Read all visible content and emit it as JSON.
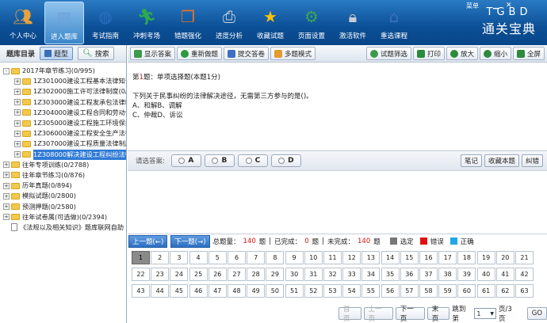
{
  "topbar": {
    "buttons": [
      {
        "label": "个人中心",
        "icon": "user-icon",
        "color": "#e9a13b"
      },
      {
        "label": "进入题库",
        "icon": "books-icon",
        "color": "#6ea0d8"
      },
      {
        "label": "考试指南",
        "icon": "globe-icon",
        "color": "#2a6fc0"
      },
      {
        "label": "冲刺考场",
        "icon": "runner-icon",
        "color": "#2fa84f"
      },
      {
        "label": "错题强化",
        "icon": "book-icon",
        "color": "#e3722b"
      },
      {
        "label": "进度分析",
        "icon": "printer-icon",
        "color": "#cfd5dd"
      },
      {
        "label": "收藏试题",
        "icon": "star-icon",
        "color": "#f4c20d"
      },
      {
        "label": "页面设置",
        "icon": "gear-icon",
        "color": "#3ea651"
      },
      {
        "label": "激活软件",
        "icon": "lock-icon",
        "color": "#c8ccd3"
      },
      {
        "label": "重选课程",
        "icon": "home-icon",
        "color": "#3d6fc4"
      }
    ],
    "menu_caption": "菜单",
    "brand_en": "TGBD",
    "brand_cn": "通关宝典"
  },
  "left": {
    "title": "题库目录",
    "btn_type": "题型",
    "btn_search": "搜索",
    "tree": [
      {
        "label": "2017年章节练习(0/995)",
        "level": 0,
        "pm": "-"
      },
      {
        "label": "1Z301000建设工程基本法律知识",
        "level": 1,
        "pm": "+"
      },
      {
        "label": "1Z302000施工许可法律制度(0/8",
        "level": 1,
        "pm": "+"
      },
      {
        "label": "1Z303000建设工程发承包法律制",
        "level": 1,
        "pm": "+"
      },
      {
        "label": "1Z304000建设工程合同和劳动合",
        "level": 1,
        "pm": "+"
      },
      {
        "label": "1Z305000建设工程施工环境保护",
        "level": 1,
        "pm": "+"
      },
      {
        "label": "1Z306000建设工程安全生产法律",
        "level": 1,
        "pm": "+"
      },
      {
        "label": "1Z307000建设工程质量法律制度",
        "level": 1,
        "pm": "+"
      },
      {
        "label": "1Z308000解决建设工程纠纷法律",
        "level": 1,
        "pm": "+",
        "selected": true
      },
      {
        "label": "往年专项训练(0/2788)",
        "level": 0,
        "pm": "+"
      },
      {
        "label": "往年章节练习(0/876)",
        "level": 0,
        "pm": "+"
      },
      {
        "label": "历年真题(0/894)",
        "level": 0,
        "pm": "+"
      },
      {
        "label": "模拟试题(0/2800)",
        "level": 0,
        "pm": "+"
      },
      {
        "label": "预测押题(0/2580)",
        "level": 0,
        "pm": "+"
      },
      {
        "label": "往年试卷属(可选做)(0/2394)",
        "level": 0,
        "pm": "+"
      },
      {
        "label": "《法规以及相关知识》题库联网自助",
        "level": 0,
        "pm": "",
        "doc": true
      }
    ]
  },
  "toolbar": {
    "show_answer": "显示答案",
    "redo": "重新做题",
    "submit": "提交答卷",
    "multi_mode": "多题模式",
    "filter": "试题筛选",
    "print": "打印",
    "zoom_in": "放大",
    "zoom_out": "缩小",
    "fullscreen": "全屏"
  },
  "question": {
    "prefix": "第",
    "number": "1",
    "suffix": "题：单项选择题(本题1分)",
    "stem": "下列关于民事纠纷的法律解决途径，无需第三方参与的是()。",
    "opt_line1": "A、和解B、调解",
    "opt_line2": "C、仲裁D、诉讼"
  },
  "answer": {
    "label": "请选答案:",
    "options": [
      "A",
      "B",
      "C",
      "D"
    ],
    "notes": "笔记",
    "favorite": "收藏本题",
    "correct_error": "纠错"
  },
  "stats": {
    "prev": "上一题(←)",
    "next": "下一题(→)",
    "total_label": "总题量：",
    "total": "140",
    "unit": "题",
    "done_label": "已完成：",
    "done": "0",
    "undone_label": "未完成：",
    "undone": "140",
    "legend_selected": "选定",
    "legend_wrong": "错误",
    "legend_right": "正确",
    "color_selected": "#777777",
    "color_wrong": "#e01010",
    "color_right": "#1ea7e8"
  },
  "grid": {
    "numbers": [
      1,
      2,
      3,
      4,
      5,
      6,
      7,
      8,
      9,
      10,
      11,
      12,
      13,
      14,
      15,
      16,
      17,
      18,
      19,
      20,
      21,
      22,
      23,
      24,
      25,
      26,
      27,
      28,
      29,
      30,
      31,
      32,
      33,
      34,
      35,
      36,
      37,
      38,
      39,
      40,
      41,
      42,
      43,
      44,
      45,
      46,
      47,
      48,
      49,
      50,
      51,
      52,
      53,
      54,
      55,
      56,
      57,
      58,
      59,
      60,
      61,
      62,
      63
    ],
    "current": 1
  },
  "pager": {
    "first": "首页",
    "prev": "上一页",
    "next": "下一页",
    "last": "末页",
    "jump_label": "跳到第",
    "page": "1",
    "page_total": "页/3页",
    "go": "GO"
  }
}
